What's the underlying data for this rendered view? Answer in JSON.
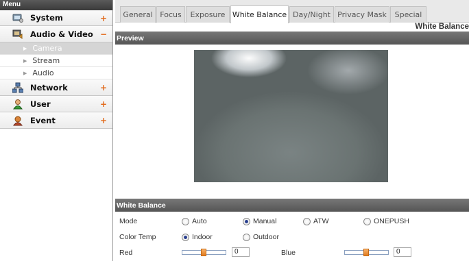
{
  "sidebar": {
    "header": "Menu",
    "categories": [
      {
        "label": "System",
        "toggle": "+",
        "icon": "system-icon"
      },
      {
        "label": "Audio & Video",
        "toggle": "−",
        "icon": "audio-video-icon"
      },
      {
        "label": "Network",
        "toggle": "+",
        "icon": "network-icon"
      },
      {
        "label": "User",
        "toggle": "+",
        "icon": "user-icon"
      },
      {
        "label": "Event",
        "toggle": "+",
        "icon": "event-icon"
      }
    ],
    "subitems": [
      {
        "label": "Camera",
        "active": true
      },
      {
        "label": "Stream",
        "active": false
      },
      {
        "label": "Audio",
        "active": false
      }
    ]
  },
  "tabs": [
    {
      "label": "General"
    },
    {
      "label": "Focus"
    },
    {
      "label": "Exposure"
    },
    {
      "label": "White Balance",
      "active": true
    },
    {
      "label": "Day/Night"
    },
    {
      "label": "Privacy Mask"
    },
    {
      "label": "Special"
    }
  ],
  "page_title": "White Balance",
  "preview": {
    "title": "Preview"
  },
  "white_balance": {
    "title": "White Balance",
    "mode": {
      "label": "Mode",
      "options": [
        "Auto",
        "Manual",
        "ATW",
        "ONEPUSH"
      ],
      "selected": "Manual"
    },
    "color_temp": {
      "label": "Color Temp",
      "options": [
        "Indoor",
        "Outdoor"
      ],
      "selected": "Indoor"
    },
    "red": {
      "label": "Red",
      "value": "0",
      "slider_fraction": 0.5
    },
    "blue": {
      "label": "Blue",
      "value": "0",
      "slider_fraction": 0.5
    }
  },
  "colors": {
    "accent": "#e26a1b",
    "bar": "#666666",
    "radio_dot": "#2a3f8f"
  }
}
